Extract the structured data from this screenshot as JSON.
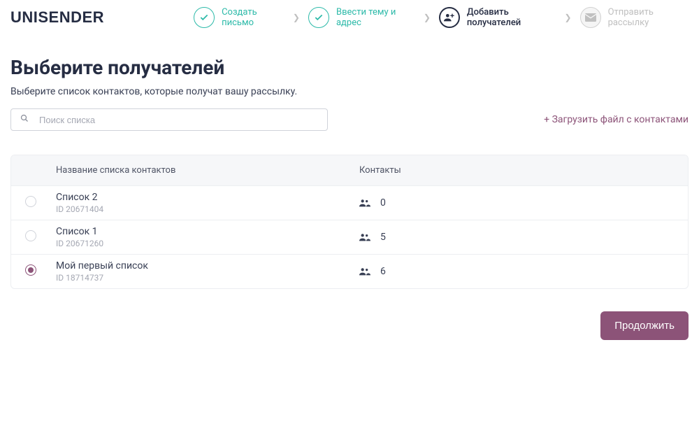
{
  "brand": "UNISENDER",
  "stepper": {
    "steps": [
      {
        "label": "Создать письмо",
        "state": "done"
      },
      {
        "label": "Ввести тему и адрес",
        "state": "done"
      },
      {
        "label": "Добавить получателей",
        "state": "active"
      },
      {
        "label": "Отправить рассылку",
        "state": "disabled"
      }
    ]
  },
  "page": {
    "title": "Выберите получателей",
    "subtitle": "Выберите список контактов, которые получат вашу рассылку."
  },
  "search": {
    "placeholder": "Поиск списка"
  },
  "upload_link": "+ Загрузить файл с контактами",
  "table": {
    "headers": {
      "name": "Название списка контактов",
      "contacts": "Контакты"
    },
    "rows": [
      {
        "name": "Список 2",
        "id_label": "ID 20671404",
        "contacts": "0",
        "selected": false
      },
      {
        "name": "Список 1",
        "id_label": "ID 20671260",
        "contacts": "5",
        "selected": false
      },
      {
        "name": "Мой первый список",
        "id_label": "ID 18714737",
        "contacts": "6",
        "selected": true
      }
    ]
  },
  "continue_label": "Продолжить"
}
